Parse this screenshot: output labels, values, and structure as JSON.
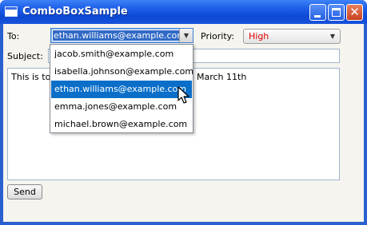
{
  "window": {
    "title": "ComboBoxSample"
  },
  "form": {
    "to_label": "To:",
    "to_value": "ethan.williams@example.com",
    "priority_label": "Priority:",
    "priority_value": "High",
    "priority_color": "#e00000",
    "subject_label": "Subject:",
    "subject_value": "",
    "body_text_start": "This is to",
    "body_text_end": "March 11th",
    "send_label": "Send"
  },
  "dropdown": {
    "items": [
      "jacob.smith@example.com",
      "isabella.johnson@example.com",
      "ethan.williams@example.com",
      "emma.jones@example.com",
      "michael.brown@example.com"
    ],
    "highlighted_item": "ethan.williams@example.com"
  },
  "colors": {
    "titlebar": "#0c48d2",
    "highlight": "#0b6fc9",
    "client_bg": "#f5f4ee"
  }
}
